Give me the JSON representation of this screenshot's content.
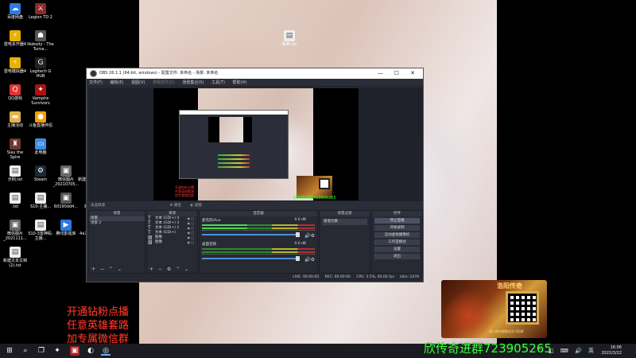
{
  "desktop": {
    "icons_left": [
      {
        "label": "百度网盘",
        "icon": "cloud-icon",
        "color": "#2c7be5",
        "glyph": "☁"
      },
      {
        "label": "Legion TD 2",
        "icon": "game-icon",
        "color": "#8a2a2a",
        "glyph": "⚔"
      },
      {
        "label": "雷电多开器4",
        "icon": "thunder-icon",
        "color": "#e8b000",
        "glyph": "⚡"
      },
      {
        "label": "Nobody - The Turna...",
        "icon": "game-icon",
        "color": "#555",
        "glyph": "☗"
      },
      {
        "label": "雷电模拟器4",
        "icon": "thunder-icon",
        "color": "#e8b000",
        "glyph": "⚡"
      },
      {
        "label": "Logitech G HUB",
        "icon": "logitech-icon",
        "color": "#222",
        "glyph": "G"
      },
      {
        "label": "QQ游戏",
        "icon": "qq-icon",
        "color": "#d33",
        "glyph": "Q"
      },
      {
        "label": "Vampire Survivors",
        "icon": "game-icon",
        "color": "#a11",
        "glyph": "✦"
      },
      {
        "label": "主播活动",
        "icon": "folder-icon",
        "color": "#e6b34a",
        "glyph": "▬"
      },
      {
        "label": "斗鱼直播伴侣",
        "icon": "douyu-icon",
        "color": "#f5a000",
        "glyph": "●"
      },
      {
        "label": "Slay the Spire",
        "icon": "game-icon",
        "color": "#6a3a2a",
        "glyph": "♜"
      },
      {
        "label": "此电脑",
        "icon": "computer-icon",
        "color": "#3a8ee6",
        "glyph": "▭"
      },
      {
        "label": "示例.txt",
        "icon": "file-icon",
        "color": "#eee",
        "glyph": "▤"
      },
      {
        "label": "Steam",
        "icon": "steam-icon",
        "color": "#1b2838",
        "glyph": "⚙"
      },
      {
        "label": "微信图片_20210705...",
        "icon": "image-icon",
        "color": "#666",
        "glyph": "▣"
      },
      {
        "label": "新建文件夹 (2)",
        "icon": "folder-icon",
        "color": "#e6b34a",
        "glyph": "▬"
      },
      {
        "label": ".txt",
        "icon": "file-icon",
        "color": "#eee",
        "glyph": "▤"
      },
      {
        "label": "S10-主播...",
        "icon": "file-icon",
        "color": "#eee",
        "glyph": "▤"
      },
      {
        "label": "60190dd4...",
        "icon": "image-icon",
        "color": "#555",
        "glyph": "▣"
      },
      {
        "label": "家乐.txt",
        "icon": "file-icon",
        "color": "#eee",
        "glyph": "▤"
      },
      {
        "label": "微信图片_2021111...",
        "icon": "image-icon",
        "color": "#666",
        "glyph": "▣"
      },
      {
        "label": "S10-3雷神码-主播...",
        "icon": "file-icon",
        "color": "#eee",
        "glyph": "▤"
      },
      {
        "label": "腾讯影视库",
        "icon": "video-icon",
        "color": "#2a7ae2",
        "glyph": "▶"
      },
      {
        "label": "4a7eed4b...",
        "icon": "image-icon",
        "color": "#555",
        "glyph": "▣"
      },
      {
        "label": "新建文本文档 (2).txt",
        "icon": "file-icon",
        "color": "#eee",
        "glyph": "▤"
      }
    ],
    "icon_wall_file": "贩卖.txt"
  },
  "obs": {
    "title": "OBS 26.1.1 (64-bit, windows) - 配置文件: 未命名 - 场景: 未命名",
    "window_buttons": [
      "—",
      "☐",
      "✕"
    ],
    "menu": [
      "文件(F)",
      "编辑(E)",
      "视图(V)",
      "停靠部件(D)",
      "场景集合(S)",
      "工具(T)",
      "帮助(H)"
    ],
    "filter_bar": {
      "no_source": "未选择源",
      "properties": "属性",
      "filters": "滤镜"
    },
    "canvas_ad_text": "欣传奇进群723905265",
    "canvas_red_text": "开通钻粉点播\n任意英雄套路\n加专属微信群",
    "docks": {
      "scenes": {
        "header": "场景",
        "items": [
          "场景",
          "场景 2"
        ]
      },
      "sources": {
        "header": "来源",
        "items": [
          {
            "icon": "T",
            "label": "文本 (GDI+) 4"
          },
          {
            "icon": "T",
            "label": "文本 (GDI+) 3"
          },
          {
            "icon": "T",
            "label": "文本 (GDI+) 2"
          },
          {
            "icon": "T",
            "label": "文本 (GDI+)"
          },
          {
            "icon": "▨",
            "label": "图像"
          },
          {
            "icon": "▨",
            "label": "图像"
          }
        ]
      },
      "mixer": {
        "header": "混音器",
        "tracks": [
          {
            "name": "麦克风/Aux",
            "db": "0.0 dB"
          },
          {
            "name": "桌面音频",
            "db": "0.0 dB"
          }
        ]
      },
      "transitions": {
        "header": "场景过渡",
        "select": "渐变切换"
      },
      "controls": {
        "header": "控件",
        "buttons": [
          "停止直播",
          "开始录制",
          "启动虚拟摄像机",
          "工作室模式",
          "设置",
          "退出"
        ]
      }
    },
    "status": {
      "live": "LIVE: 00:00:00",
      "rec": "REC: 00:00:00",
      "cpu": "CPU: 3.5%, 60.00 fps",
      "kbps": "kb/s: 2478"
    }
  },
  "overlay": {
    "red_lines": [
      "开通钻粉点播",
      "任意英雄套路",
      "加专属微信群"
    ],
    "green_text": "欣传奇进群723905265",
    "game_brand": "浩阳传奇",
    "game_sub": "加入群内领取礼包 QQ群"
  },
  "taskbar": {
    "time": "16:06",
    "date": "2022/3/22",
    "tray_icons": "^ ◧ ⌨ 🔊 英"
  }
}
